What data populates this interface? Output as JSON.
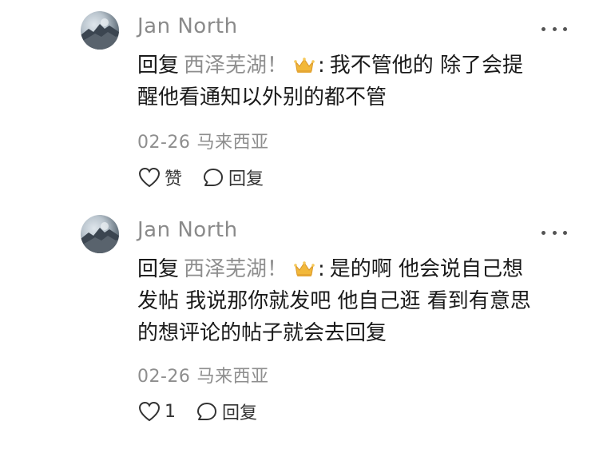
{
  "comments": [
    {
      "username": "Jan North",
      "reply_prefix": "回复",
      "mention": "西泽芜湖！",
      "crown_icon": "crown-icon",
      "colon": ":",
      "lines": [
        "我不管他的 除了会提",
        "醒他看通知以外别的都不管"
      ],
      "date": "02-26",
      "location": "马来西亚",
      "like_label": "赞",
      "reply_label": "回复"
    },
    {
      "username": "Jan North",
      "reply_prefix": "回复",
      "mention": "西泽芜湖！",
      "crown_icon": "crown-icon",
      "colon": ":",
      "lines": [
        "是的啊 他会说自己想",
        "发帖 我说那你就发吧 他自己逛 看到有意思",
        "的想评论的帖子就会去回复"
      ],
      "date": "02-26",
      "location": "马来西亚",
      "like_label": "1",
      "reply_label": "回复"
    }
  ],
  "colors": {
    "text": "#1a1a1a",
    "muted": "#8e8e8e",
    "crown": "#f2b83a"
  }
}
